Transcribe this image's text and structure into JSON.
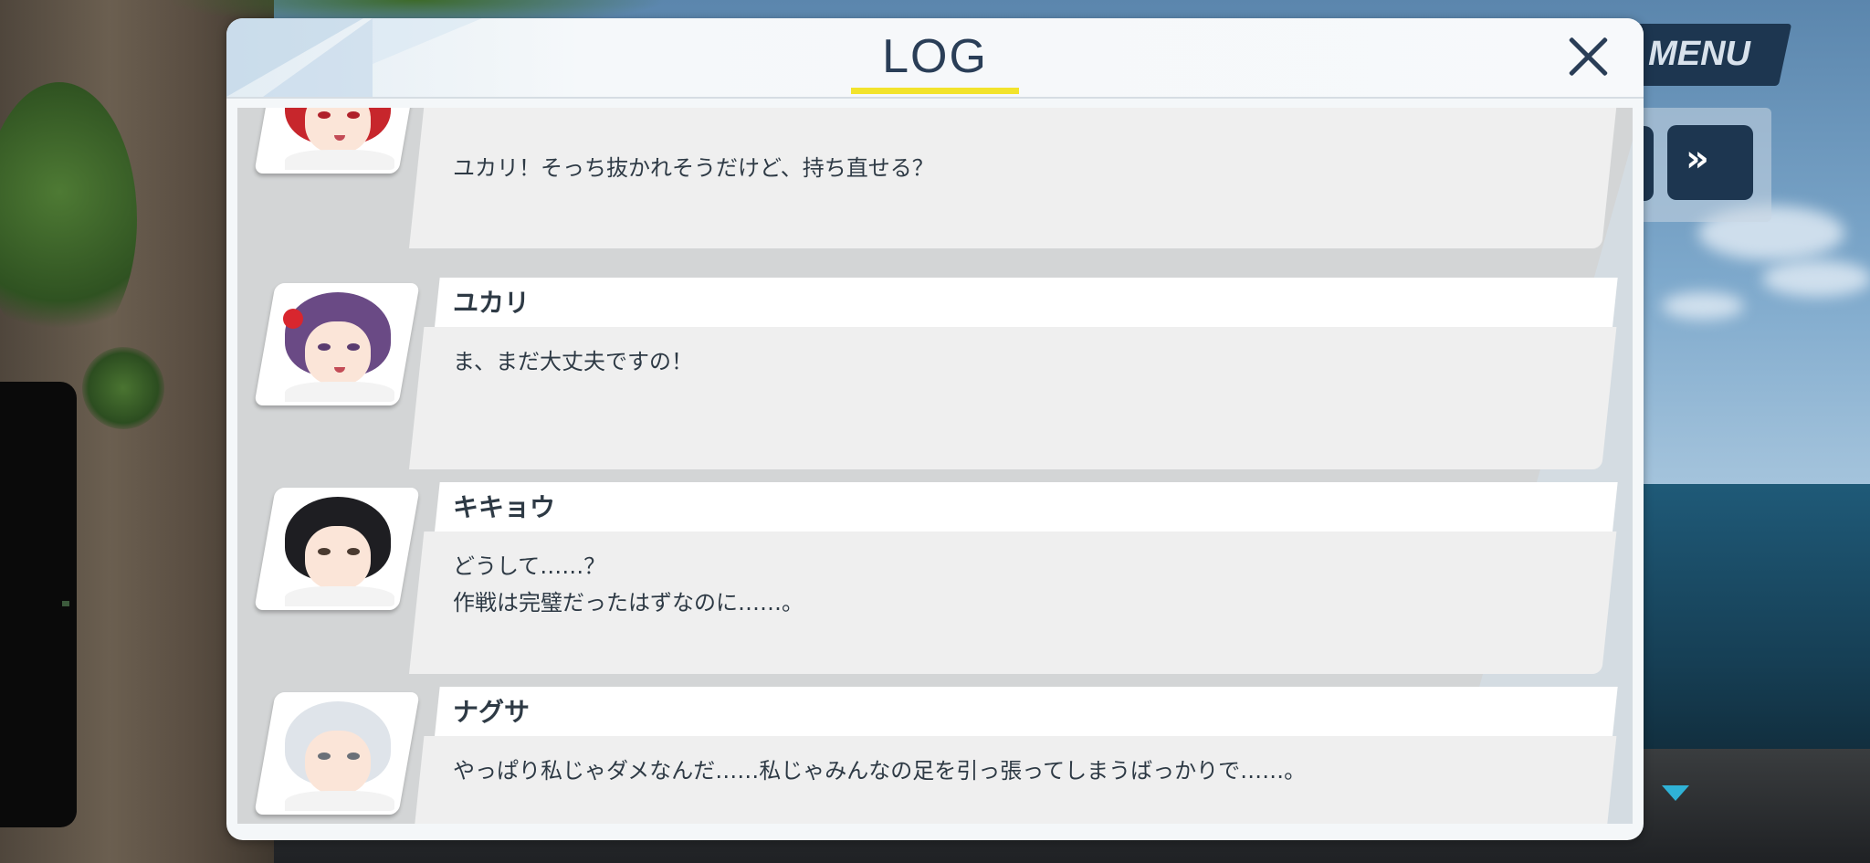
{
  "top_menu": {
    "menu_label": "MENU",
    "skip_label": "»"
  },
  "log": {
    "title": "LOG",
    "entries": [
      {
        "speaker": "",
        "lines": [
          "ユカリ！そっち抜かれそうだけど、持ち直せる？"
        ]
      },
      {
        "speaker": "ユカリ",
        "lines": [
          "ま、まだ大丈夫ですの！"
        ]
      },
      {
        "speaker": "キキョウ",
        "lines": [
          "どうして……？",
          "作戦は完璧だったはずなのに……。"
        ]
      },
      {
        "speaker": "ナグサ",
        "lines": [
          "やっぱり私じゃダメなんだ……私じゃみんなの足を引っ張ってしまうばっかりで……。"
        ]
      }
    ]
  },
  "colors": {
    "title_underline": "#f2e32c",
    "dark_navy": "#1d3650",
    "scroll_indicator": "#2fb2d6"
  },
  "icons": {
    "close": "close-icon",
    "skip": "fast-forward-icon",
    "scroll_down": "scroll-down-indicator-icon"
  }
}
